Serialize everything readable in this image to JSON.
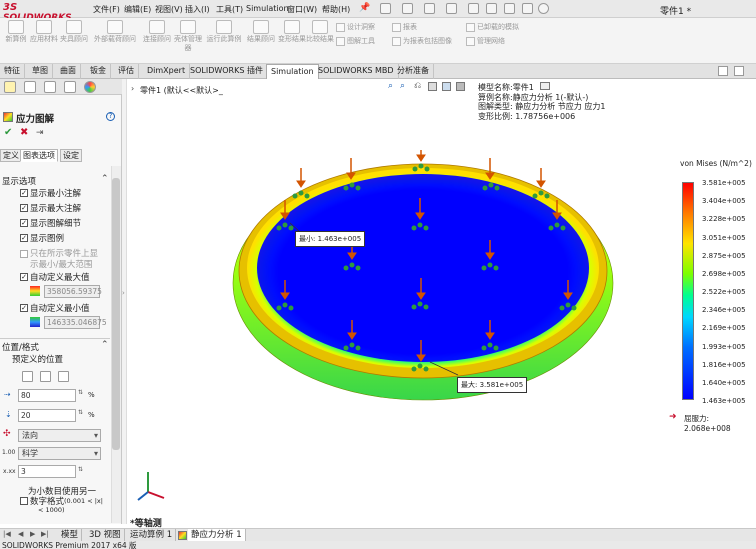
{
  "app": {
    "brand": "SOLIDWORKS",
    "brand_prefix": "3S",
    "document_title": "零件1 *",
    "status_bar": "SOLIDWORKS Premium 2017 x64 版"
  },
  "menu": {
    "items": [
      "文件(F)",
      "编辑(E)",
      "视图(V)",
      "插入(I)",
      "工具(T)",
      "Simulation",
      "窗口(W)",
      "帮助(H)"
    ]
  },
  "ribbon": {
    "buttons": [
      {
        "label": "新算例"
      },
      {
        "label": "应用材料"
      },
      {
        "label": "夹具顾问"
      },
      {
        "label": "外部载荷顾问"
      },
      {
        "label": "连接顾问"
      },
      {
        "label": "壳体管理器"
      },
      {
        "label": "运行此算例"
      },
      {
        "label": "结果顾问"
      },
      {
        "label": "变形结果"
      },
      {
        "label": "比较结果"
      }
    ],
    "small": [
      {
        "label": "设计洞察"
      },
      {
        "label": "图解工具"
      },
      {
        "label": "报表"
      },
      {
        "label": "为报表包括图像"
      },
      {
        "label": "已卸载的模拟"
      },
      {
        "label": "管理网络"
      }
    ]
  },
  "command_tabs": [
    "特征",
    "草图",
    "曲面",
    "钣金",
    "评估",
    "DimXpert",
    "SOLIDWORKS 插件",
    "Simulation",
    "SOLIDWORKS MBD",
    "分析准备"
  ],
  "command_tabs_active": "Simulation",
  "panel": {
    "title": "应力图解",
    "subtabs": [
      "定义",
      "图表选项",
      "设定"
    ],
    "active_subtab": "图表选项",
    "section_display": "显示选项",
    "options": [
      {
        "label": "显示最小注解",
        "checked": true
      },
      {
        "label": "显示最大注解",
        "checked": true
      },
      {
        "label": "显示图解细节",
        "checked": true
      },
      {
        "label": "显示图例",
        "checked": true
      }
    ],
    "only_show_line1": "只在所示零件上显",
    "only_show_line2": "示最小/最大范围",
    "auto_max_label": "自动定义最大值",
    "auto_max_value": "358056.59375",
    "auto_min_label": "自动定义最小值",
    "auto_min_value": "146335.046875",
    "section_position": "位置/格式",
    "predefined_position": "预定义的位置",
    "pos_x": "80",
    "pos_y": "20",
    "percent": "%",
    "orientation": "法向",
    "number_format": "科学",
    "decimals": "3",
    "small_numbers_line1": "为小数目使用另一",
    "small_numbers_line2": "数字格式",
    "small_numbers_line3": "(0.001 < |x|",
    "small_numbers_line4": "< 1000)"
  },
  "viewport": {
    "tree_item": "零件1 (默认<<默认>_",
    "info_lines": [
      "模型名称:零件1",
      "算例名称:静应力分析 1(-默认-)",
      "图解类型: 静应力分析 节应力 应力1",
      "变形比例: 1.78756e+006"
    ],
    "min_label": "最小:",
    "min_value": "1.463e+005",
    "max_label": "最大:",
    "max_value": "3.581e+005",
    "view_label": "*等轴测",
    "legend_title": "von Mises (N/m^2)",
    "legend_values": [
      "3.581e+005",
      "3.404e+005",
      "3.228e+005",
      "3.051e+005",
      "2.875e+005",
      "2.698e+005",
      "2.522e+005",
      "2.346e+005",
      "2.169e+005",
      "1.993e+005",
      "1.816e+005",
      "1.640e+005",
      "1.463e+005"
    ],
    "yield_label": "屈服力: 2.068e+008"
  },
  "bottom_tabs": [
    "模型",
    "3D 视图",
    "运动算例 1",
    "静应力分析 1"
  ],
  "bottom_tabs_active": "静应力分析 1",
  "colors": {
    "brand": "#c8102e",
    "accent_green": "#2e9a3e",
    "stress_max": "#ff0000",
    "stress_min": "#0000ff"
  }
}
